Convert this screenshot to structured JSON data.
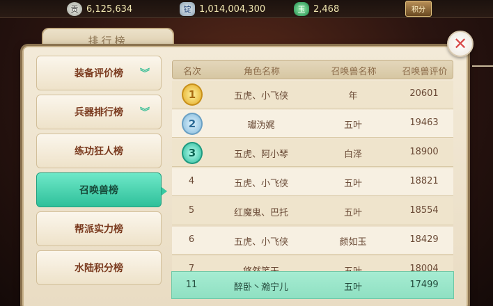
{
  "currency": {
    "silver_icon_glyph": "贡",
    "silver_value": "6,125,634",
    "ingot_icon_glyph": "锭",
    "ingot_value": "1,014,004,300",
    "jade_icon_glyph": "玉",
    "jade_value": "2,468",
    "jifen_label": "积分"
  },
  "panel": {
    "title": "排行榜",
    "close_glyph": "✕"
  },
  "nav": {
    "items": [
      {
        "label": "装备评价榜",
        "has_chevron": true
      },
      {
        "label": "兵器排行榜",
        "has_chevron": true
      },
      {
        "label": "练功狂人榜",
        "has_chevron": false
      },
      {
        "label": "召唤兽榜",
        "has_chevron": false,
        "active": true
      },
      {
        "label": "帮派实力榜",
        "has_chevron": false
      },
      {
        "label": "水陆积分榜",
        "has_chevron": false
      }
    ],
    "chevron_glyph": "︾"
  },
  "table": {
    "headers": [
      "名次",
      "角色名称",
      "召唤兽名称",
      "召唤兽评价"
    ],
    "rows": [
      {
        "rank": "1",
        "role": "五虎、小飞侠",
        "beast": "年",
        "score": "20601"
      },
      {
        "rank": "2",
        "role": "瓛沩娓",
        "beast": "五叶",
        "score": "19463"
      },
      {
        "rank": "3",
        "role": "五虎、阿小琴",
        "beast": "白泽",
        "score": "18900"
      },
      {
        "rank": "4",
        "role": "五虎、小飞侠",
        "beast": "五叶",
        "score": "18821"
      },
      {
        "rank": "5",
        "role": "红魔鬼、巴托",
        "beast": "五叶",
        "score": "18554"
      },
      {
        "rank": "6",
        "role": "五虎、小飞侠",
        "beast": "颜如玉",
        "score": "18429"
      },
      {
        "rank": "7",
        "role": "悠然笑天",
        "beast": "五叶",
        "score": "18004"
      }
    ],
    "self_row": {
      "rank": "11",
      "role": "醉卧丶瀚宁儿",
      "beast": "五叶",
      "score": "17499"
    }
  },
  "colors": {
    "accent_teal": "#2fc09a",
    "panel_bg": "#f3ead8",
    "text_brown": "#6a4a36"
  }
}
